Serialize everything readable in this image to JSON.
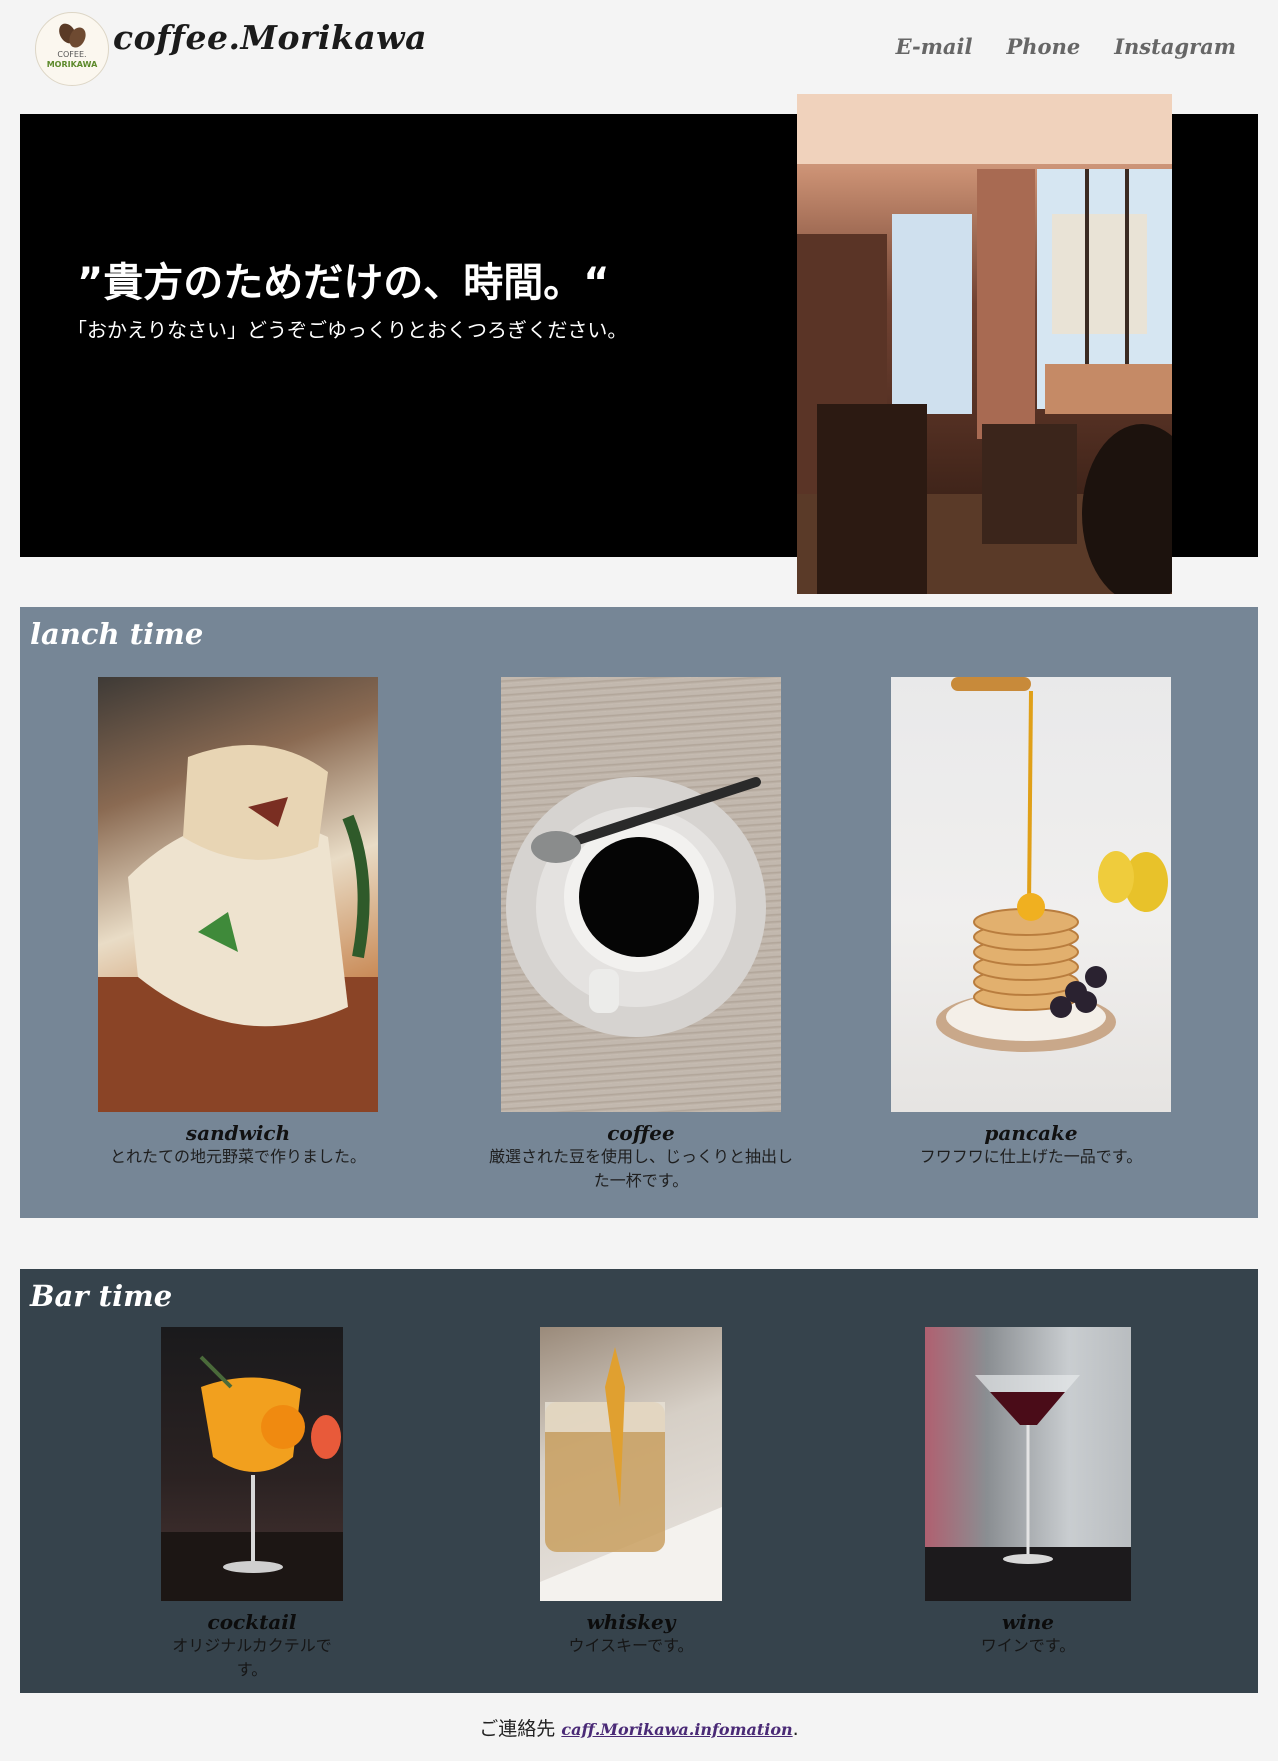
{
  "header": {
    "logo_line1": "COFEE.",
    "logo_line2": "MORIKAWA",
    "brand": "coffee.Morikawa",
    "nav": [
      "E-mail",
      "Phone",
      "Instagram"
    ]
  },
  "hero": {
    "title": "”貴方のためだけの、時間。“",
    "subtitle": "「おかえりなさい」どうぞごゆっくりとおくつろぎください。"
  },
  "lunch": {
    "title": "lanch time",
    "items": [
      {
        "name": "sandwich",
        "desc": "とれたての地元野菜で作りました。"
      },
      {
        "name": "coffee",
        "desc": "厳選された豆を使用し、じっくりと抽出した一杯です。"
      },
      {
        "name": "pancake",
        "desc": "フワフワに仕上げた一品です。"
      }
    ]
  },
  "bar": {
    "title": "Bar time",
    "items": [
      {
        "name": "cocktail",
        "desc": "オリジナルカクテルです。"
      },
      {
        "name": "whiskey",
        "desc": "ウイスキーです。"
      },
      {
        "name": "wine",
        "desc": "ワインです。"
      }
    ]
  },
  "footer": {
    "prefix": "ご連絡先 ",
    "link": "caff.Morikawa.infomation",
    "suffix": "."
  }
}
